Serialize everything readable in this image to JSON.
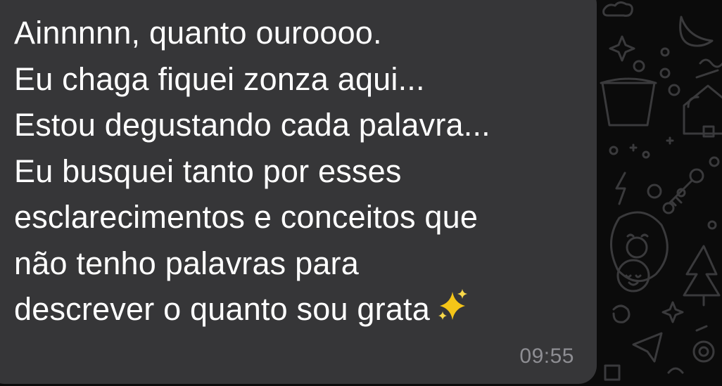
{
  "message": {
    "lines": [
      "Ainnnnn, quanto ouroooo.",
      "Eu chaga fiquei zonza aqui...",
      "Estou degustando cada palavra...",
      "Eu busquei tanto por esses",
      "esclarecimentos e conceitos que",
      "não tenho palavras para",
      "descrever o quanto sou grata"
    ],
    "emoji": "sparkles-icon",
    "time": "09:55"
  },
  "colors": {
    "bubble": "#363638",
    "wallpaper": "#0b0b0b",
    "text": "#ffffff",
    "timestamp": "#8e8e93",
    "doodle": "#3a3a3c"
  }
}
